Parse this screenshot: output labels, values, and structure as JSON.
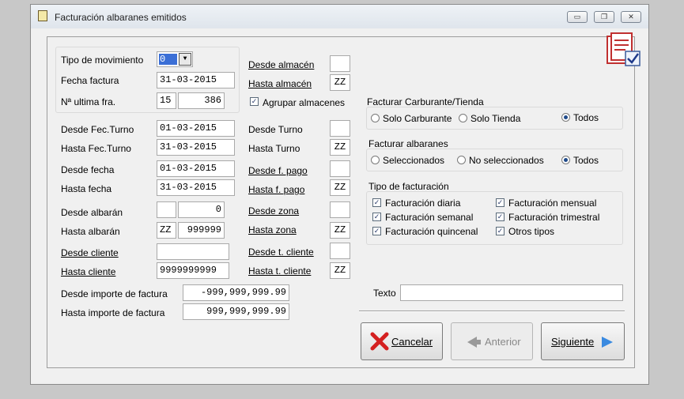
{
  "window": {
    "title": "Facturación albaranes emitidos",
    "minimize": "▭",
    "restore": "❐",
    "close": "✕"
  },
  "left": {
    "tipo_movimiento": {
      "label": "Tipo de movimiento",
      "value": "0",
      "arrow": "▼"
    },
    "fecha_factura": {
      "label": "Fecha factura",
      "value": "31-03-2015"
    },
    "ultima_fra": {
      "label": "Nª ultima fra.",
      "serie": "15",
      "numero": "386"
    },
    "desde_fec_turno": {
      "label": "Desde Fec.Turno",
      "value": "01-03-2015"
    },
    "hasta_fec_turno": {
      "label": "Hasta Fec.Turno",
      "value": "31-03-2015"
    },
    "desde_fecha": {
      "label": "Desde fecha",
      "value": "01-03-2015"
    },
    "hasta_fecha": {
      "label": "Hasta fecha",
      "value": "31-03-2015"
    },
    "desde_albaran": {
      "label": "Desde albarán",
      "serie": "",
      "numero": "0"
    },
    "hasta_albaran": {
      "label": "Hasta albarán",
      "serie": "ZZ",
      "numero": "999999"
    },
    "desde_cliente": {
      "label": "Desde cliente",
      "value": ""
    },
    "hasta_cliente": {
      "label": "Hasta cliente",
      "value": "9999999999"
    },
    "desde_importe": {
      "label": "Desde importe de factura",
      "value": "-999,999,999.99"
    },
    "hasta_importe": {
      "label": "Hasta importe de factura",
      "value": "999,999,999.99"
    }
  },
  "middle": {
    "desde_almacen": {
      "label": "Desde almacén",
      "value": ""
    },
    "hasta_almacen": {
      "label": "Hasta almacén",
      "value": "ZZ"
    },
    "agrupar": {
      "label": "Agrupar almacenes",
      "mark": "✓"
    },
    "desde_turno": {
      "label": "Desde Turno",
      "value": ""
    },
    "hasta_turno": {
      "label": "Hasta Turno",
      "value": "ZZ"
    },
    "desde_fpago": {
      "label": "Desde f. pago",
      "value": ""
    },
    "hasta_fpago": {
      "label": "Hasta f. pago",
      "value": "ZZ"
    },
    "desde_zona": {
      "label": "Desde zona",
      "value": ""
    },
    "hasta_zona": {
      "label": "Hasta zona",
      "value": "ZZ"
    },
    "desde_tcliente": {
      "label": "Desde t. cliente",
      "value": ""
    },
    "hasta_tcliente": {
      "label": "Hasta t. cliente",
      "value": "ZZ"
    }
  },
  "right": {
    "facturar_carburante": {
      "title": "Facturar Carburante/Tienda",
      "options": [
        "Solo Carburante",
        "Solo Tienda",
        "Todos"
      ],
      "selected": "Todos"
    },
    "facturar_albaranes": {
      "title": "Facturar albaranes",
      "options": [
        "Seleccionados",
        "No seleccionados",
        "Todos"
      ],
      "selected": "Todos"
    },
    "tipo_facturacion": {
      "title": "Tipo de facturación",
      "mark": "✓",
      "options": [
        "Facturación diaria",
        "Facturación semanal",
        "Facturación quincenal",
        "Facturación mensual",
        "Facturación trimestral",
        "Otros tipos"
      ]
    },
    "texto": {
      "label": "Texto",
      "value": ""
    }
  },
  "buttons": {
    "cancelar": {
      "label": "Cancelar"
    },
    "anterior": {
      "label": "Anterior"
    },
    "siguiente": {
      "label": "Siguiente"
    }
  },
  "colors": {
    "accent": "#1f4a8a",
    "cancel_red": "#d42020",
    "next_blue": "#3a8ae0"
  }
}
